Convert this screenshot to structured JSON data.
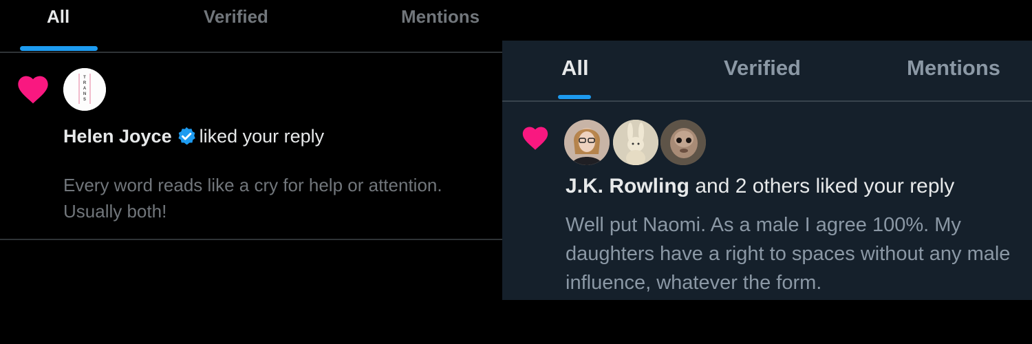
{
  "left": {
    "tabs": [
      {
        "label": "All",
        "active": true
      },
      {
        "label": "Verified",
        "active": false
      },
      {
        "label": "Mentions",
        "active": false
      }
    ],
    "notification": {
      "icon": "heart-icon",
      "avatar": "avatar",
      "avatar_text": "TRANS",
      "user": "Helen Joyce",
      "verified": true,
      "action": "liked your reply",
      "reply_text": "Every word reads like a cry for help or attention. Usually both!"
    }
  },
  "right": {
    "tabs": [
      {
        "label": "All",
        "active": true
      },
      {
        "label": "Verified",
        "active": false
      },
      {
        "label": "Mentions",
        "active": false
      }
    ],
    "notification": {
      "icon": "heart-icon",
      "avatar_count": 3,
      "user": "J.K. Rowling",
      "action": "and 2 others liked your reply",
      "reply_text": "Well put Naomi. As a male I agree 100%. My daughters have a right to spaces without any male influence, whatever the form."
    }
  },
  "colors": {
    "accent": "#1d9bf0",
    "heart": "#f91880",
    "left_background": "#000000",
    "right_background": "#15202b"
  }
}
